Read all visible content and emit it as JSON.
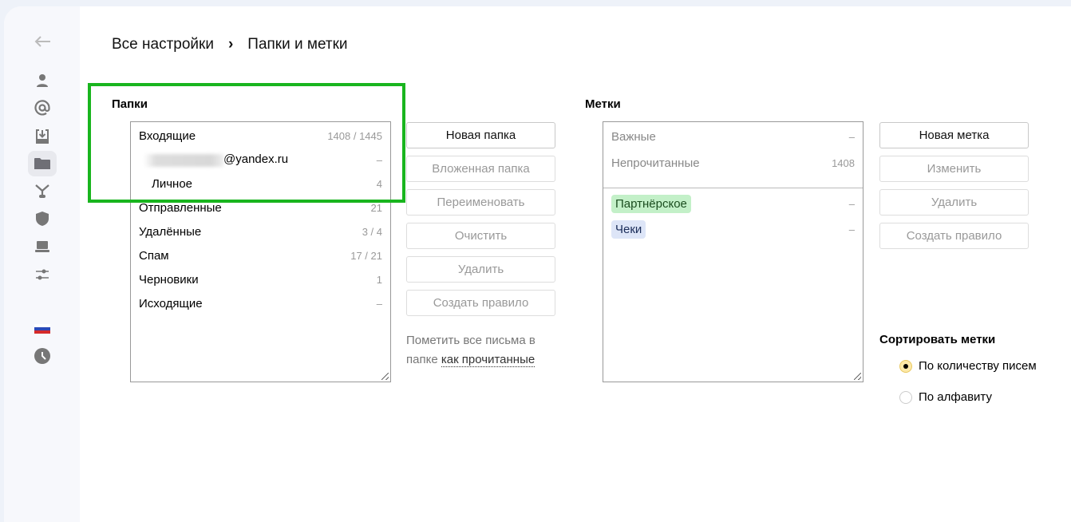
{
  "breadcrumb": {
    "root": "Все настройки",
    "separator": "›",
    "current": "Папки и метки"
  },
  "sidebar": [
    "back-icon",
    "person-icon",
    "at-icon",
    "inbox-download-icon",
    "folder-icon",
    "filter-branch-icon",
    "shield-icon",
    "laptop-icon",
    "sliders-icon",
    "russian-flag-icon",
    "clock-icon"
  ],
  "folders": {
    "title": "Папки",
    "items": [
      {
        "name": "Входящие",
        "count": "1408 / 1445"
      },
      {
        "name": "@yandex.ru",
        "count": "–"
      },
      {
        "name": "Личное",
        "count": "4"
      },
      {
        "name": "Отправленные",
        "count": "21"
      },
      {
        "name": "Удалённые",
        "count": "3 / 4"
      },
      {
        "name": "Спам",
        "count": "17 / 21"
      },
      {
        "name": "Черновики",
        "count": "1"
      },
      {
        "name": "Исходящие",
        "count": "–"
      }
    ],
    "buttons": [
      "Новая папка",
      "Вложенная папка",
      "Переименовать",
      "Очистить",
      "Удалить",
      "Создать правило"
    ],
    "mark_read_text": "Пометить все письма в папке",
    "mark_read_link": "как прочитанные"
  },
  "labels": {
    "title": "Метки",
    "system": [
      {
        "name": "Важные",
        "count": "–"
      },
      {
        "name": "Непрочитанные",
        "count": "1408"
      }
    ],
    "user": [
      {
        "name": "Партнёрское",
        "count": "–",
        "color": "#c3f0c8"
      },
      {
        "name": "Чеки",
        "count": "–",
        "color": "#dde5f7"
      }
    ],
    "buttons": [
      "Новая метка",
      "Изменить",
      "Удалить",
      "Создать правило"
    ],
    "sort_title": "Сортировать метки",
    "sort_options": [
      "По количеству писем",
      "По алфавиту"
    ],
    "sort_selected": "По количеству писем"
  },
  "highlight_color": "#19b51e"
}
